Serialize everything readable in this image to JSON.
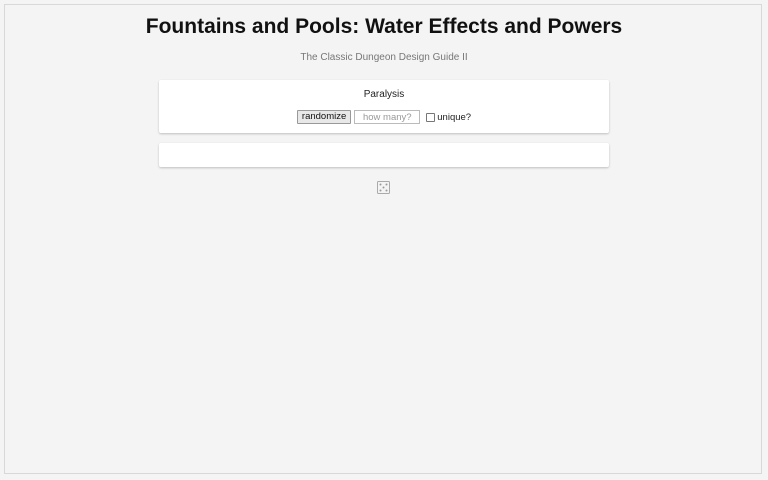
{
  "header": {
    "title": "Fountains and Pools: Water Effects and Powers",
    "subtitle": "The Classic Dungeon Design Guide II"
  },
  "generator": {
    "table_name": "Paralysis",
    "randomize_label": "randomize",
    "count_placeholder": "how many?",
    "count_value": "",
    "unique_label": "unique?",
    "unique_checked": false
  },
  "result": {
    "text": ""
  },
  "footer": {
    "icon": "dice-icon"
  }
}
